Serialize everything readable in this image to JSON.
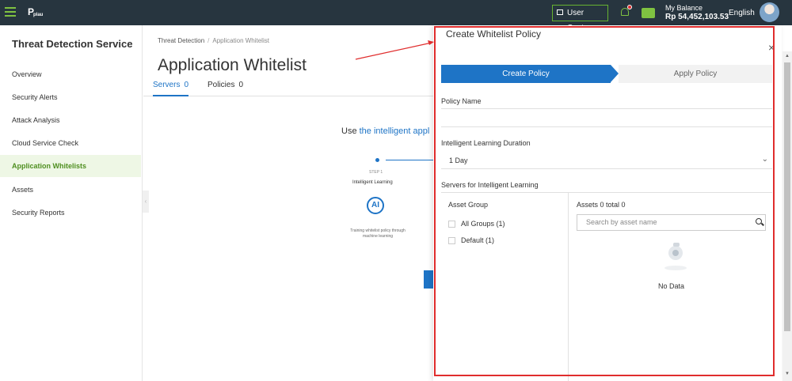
{
  "topbar": {
    "user_center_label": "User Center",
    "balance_label": "My Balance",
    "balance_value": "Rp 54,452,103.53",
    "language": "English",
    "logo_text": "plau"
  },
  "sidebar": {
    "title": "Threat Detection Service",
    "items": [
      {
        "label": "Overview"
      },
      {
        "label": "Security Alerts"
      },
      {
        "label": "Attack Analysis"
      },
      {
        "label": "Cloud Service Check"
      },
      {
        "label": "Application Whitelists"
      },
      {
        "label": "Assets"
      },
      {
        "label": "Security Reports"
      }
    ],
    "active_item": "Application Whitelists"
  },
  "main": {
    "breadcrumb": {
      "root": "Threat Detection",
      "separator": "/",
      "current": "Application Whitelist"
    },
    "title": "Application Whitelist",
    "tabs": [
      {
        "label": "Servers",
        "count": "0"
      },
      {
        "label": "Policies",
        "count": "0"
      }
    ],
    "intro_prefix": "Use",
    "intro_link": "the intelligent appl",
    "step": {
      "number": "STEP 1",
      "title": "Intelligent Learning",
      "icon_text": "AI",
      "description": "Training whitelist policy through machine learning"
    }
  },
  "drawer": {
    "title": "Create Whitelist Policy",
    "close": "×",
    "steps": [
      {
        "label": "Create Policy"
      },
      {
        "label": "Apply Policy"
      }
    ],
    "policy_name_label": "Policy Name",
    "policy_name_value": "",
    "duration_label": "Intelligent Learning Duration",
    "duration_value": "1 Day",
    "servers_label": "Servers for Intelligent Learning",
    "asset_group_head": "Asset Group",
    "groups": [
      {
        "label": "All Groups (1)"
      },
      {
        "label": "Default (1)"
      }
    ],
    "assets_head": "Assets 0 total 0",
    "search_placeholder": "Search by asset name",
    "no_data": "No Data"
  },
  "colors": {
    "topbar": "#27353f",
    "accent_green": "#7fc241",
    "primary_blue": "#1e74c6",
    "highlight_red": "#e02d2d"
  }
}
